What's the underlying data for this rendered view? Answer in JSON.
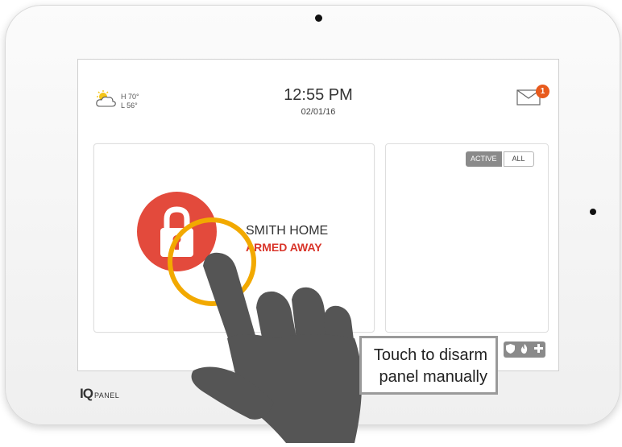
{
  "device": {
    "brand_mark": "IQ",
    "brand_text": "PANEL"
  },
  "header": {
    "weather": {
      "high": "H 70°",
      "low": "L 56°",
      "icon": "partly-sunny-icon"
    },
    "time": "12:55 PM",
    "date": "02/01/16",
    "messages": {
      "icon": "envelope-icon",
      "unread_count": "1"
    }
  },
  "security_card": {
    "location_name": "SMITH HOME",
    "status": "ARMED AWAY",
    "icon": "padlock-icon"
  },
  "sensors_panel": {
    "filters": [
      "ACTIVE",
      "ALL"
    ],
    "selected_filter": "ACTIVE"
  },
  "bottom_bar": {
    "icons": [
      "shield-icon",
      "fire-icon",
      "medical-cross-icon"
    ]
  },
  "callout": {
    "line1": "Touch to disarm",
    "line2": "panel manually"
  },
  "colors": {
    "armed_red": "#e34a3c",
    "touch_ring": "#f2a900",
    "badge_orange": "#e85a1c",
    "hand_gray": "#555555"
  }
}
